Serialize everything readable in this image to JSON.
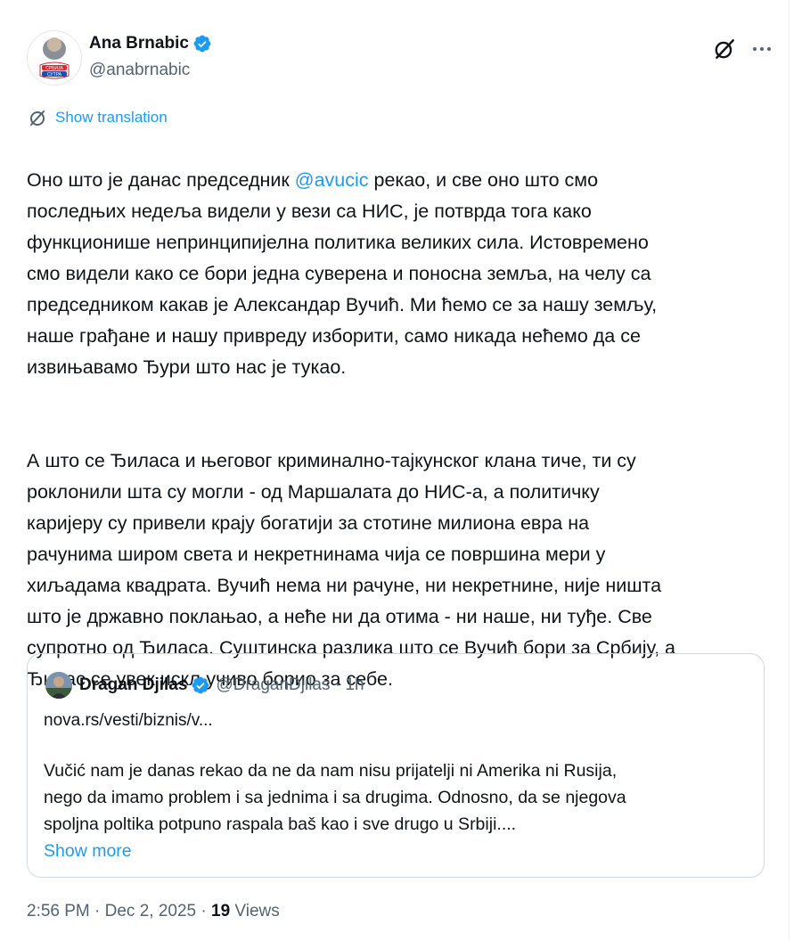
{
  "author": {
    "display_name": "Ana Brnabic",
    "handle": "@anabrnabic",
    "avatar_label": "СРБИЈА СУТРА"
  },
  "translation": {
    "label": "Show translation"
  },
  "tweet": {
    "p1_before": "Оно што је данас председник ",
    "mention": "@avucic",
    "p1_after": " рекао, и све оно што смо\nпоследњих недеља видели у вези са НИС, је потврда тога како\nфункционише непринципијелна политика великих сила. Истовремено\nсмо видели како се бори једна суверена и поносна земља, на челу са\nпредседником какав је Александар Вучић. Ми ћемо се за нашу земљу,\nнаше грађане и нашу привреду изборити, само никада нећемо да се\nизвињавамо Ђури што нас је тукао.",
    "p2": "А што се Ђиласа и његовог криминално-тајкунског клана тиче, ти су\npoклонили шта су могли - од Маршалата до НИС-а, а политичку\nкаријеру су привели крају богатији за стотине милиона евра на\nрачунима широм света и некретнинама чија се површина мери у\nхиљадама квадрата. Вучић нема ни рачуне, ни некретнине, није ништа\nшто је државно поклањао, а неће ни да отима - ни наше, ни туђе. Све\nсупротно од Ђиласа. Суштинска разлика што се Вучић бори за Србију, а\nЂилас се увек искључиво борио за себе."
  },
  "quote": {
    "display_name": "Dragan Djilas",
    "handle_time": "@DraganDjilas · 1h",
    "link": "nova.rs/vesti/biznis/v...",
    "body": "Vučić nam je danas rekao da ne da nam nisu prijatelji ni Amerika ni Rusija,\nnego da imamo problem i sa jednima i sa drugima. Odnosno,  da se njegova\nspoljna poltika potpuno raspala baš kao i sve drugo u Srbiji....",
    "show_more": "Show more"
  },
  "meta": {
    "time_date": "2:56 PM · Dec 2, 2025 · ",
    "views_count": "19",
    "views_label": " Views"
  },
  "colors": {
    "link": "#1d9bf0",
    "verified": "#1d9bf0",
    "muted": "#536471",
    "border": "#cfd9de"
  },
  "icons": [
    "verified-badge-icon",
    "grok-icon",
    "more-icon",
    "translate-icon"
  ]
}
